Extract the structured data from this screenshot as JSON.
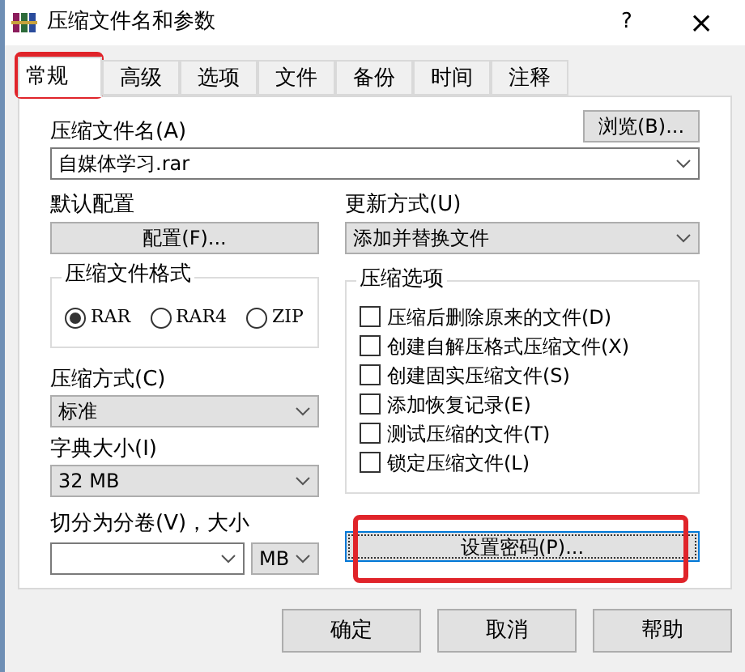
{
  "window": {
    "title": "压缩文件名和参数",
    "help": "?",
    "close": "×"
  },
  "tabs": [
    {
      "label": "常规",
      "selected": true,
      "highlighted": true
    },
    {
      "label": "高级",
      "selected": false,
      "highlighted": false
    },
    {
      "label": "选项",
      "selected": false,
      "highlighted": false
    },
    {
      "label": "文件",
      "selected": false,
      "highlighted": false
    },
    {
      "label": "备份",
      "selected": false,
      "highlighted": false
    },
    {
      "label": "时间",
      "selected": false,
      "highlighted": false
    },
    {
      "label": "注释",
      "selected": false,
      "highlighted": false
    }
  ],
  "archive_name": {
    "label": "压缩文件名(A)",
    "browse": "浏览(B)...",
    "value": "自媒体学习.rar"
  },
  "profiles": {
    "label": "默认配置",
    "button": "配置(F)..."
  },
  "update_mode": {
    "label": "更新方式(U)",
    "value": "添加并替换文件"
  },
  "archive_format": {
    "title": "压缩文件格式",
    "options": [
      {
        "label": "RAR",
        "selected": true
      },
      {
        "label": "RAR4",
        "selected": false
      },
      {
        "label": "ZIP",
        "selected": false
      }
    ]
  },
  "archive_options": {
    "title": "压缩选项",
    "items": [
      {
        "label": "压缩后删除原来的文件(D)",
        "checked": false
      },
      {
        "label": "创建自解压格式压缩文件(X)",
        "checked": false
      },
      {
        "label": "创建固实压缩文件(S)",
        "checked": false
      },
      {
        "label": "添加恢复记录(E)",
        "checked": false
      },
      {
        "label": "测试压缩的文件(T)",
        "checked": false
      },
      {
        "label": "锁定压缩文件(L)",
        "checked": false
      }
    ]
  },
  "compression_method": {
    "label": "压缩方式(C)",
    "value": "标准"
  },
  "dictionary_size": {
    "label": "字典大小(I)",
    "value": "32 MB"
  },
  "split": {
    "label": "切分为分卷(V)，大小",
    "unit": "MB"
  },
  "password_button": {
    "label": "设置密码(P)...",
    "highlighted": true
  },
  "buttons": [
    {
      "label": "确定"
    },
    {
      "label": "取消"
    },
    {
      "label": "帮助"
    }
  ]
}
